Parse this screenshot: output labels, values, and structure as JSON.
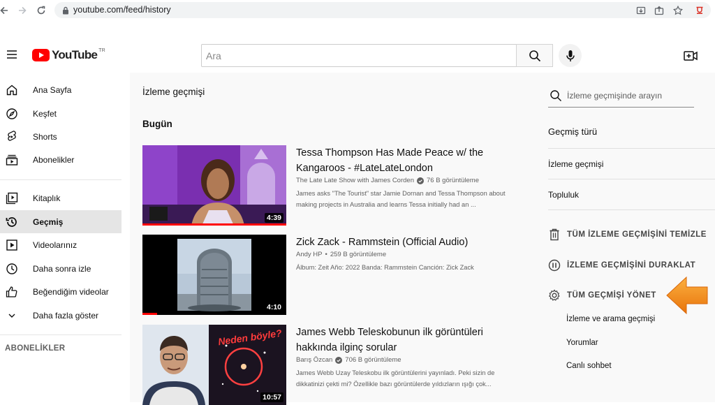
{
  "browser": {
    "url": "youtube.com/feed/history"
  },
  "header": {
    "logo_text": "YouTube",
    "logo_superscript": "TR",
    "search_placeholder": "Ara",
    "icons": [
      "menu-icon",
      "search-icon",
      "mic-icon",
      "create-video-icon"
    ]
  },
  "sidebar": {
    "items": [
      {
        "label": "Ana Sayfa",
        "icon": "home-icon"
      },
      {
        "label": "Keşfet",
        "icon": "compass-icon"
      },
      {
        "label": "Shorts",
        "icon": "shorts-icon"
      },
      {
        "label": "Abonelikler",
        "icon": "subscriptions-icon"
      },
      {
        "label": "Kitaplık",
        "icon": "library-icon"
      },
      {
        "label": "Geçmiş",
        "icon": "history-icon",
        "active": true
      },
      {
        "label": "Videolarınız",
        "icon": "your-videos-icon"
      },
      {
        "label": "Daha sonra izle",
        "icon": "clock-icon"
      },
      {
        "label": "Beğendiğim videolar",
        "icon": "thumb-up-icon"
      },
      {
        "label": "Daha fazla göster",
        "icon": "chevron-down-icon"
      }
    ],
    "section_title": "ABONELİKLER"
  },
  "main": {
    "page_title": "İzleme geçmişi",
    "date_group": "Bugün",
    "videos": [
      {
        "title": "Tessa Thompson Has Made Peace w/ the Kangaroos - #LateLateLondon",
        "channel": "The Late Late Show with James Corden",
        "verified": true,
        "views": "76 B görüntüleme",
        "description": "James asks \"The Tourist\" star Jamie Dornan and Tessa Thompson about making projects in Australia and learns Tessa initially had an ...",
        "duration": "4:39",
        "watched_fraction": 1.0
      },
      {
        "title": "Zick Zack - Rammstein (Official Audio)",
        "channel": "Andy HP",
        "verified": false,
        "views": "259 B görüntüleme",
        "description": "Álbum: Zeit Año: 2022 Banda: Rammstein Canción: Zick Zack",
        "duration": "4:10",
        "watched_fraction": 0.1
      },
      {
        "title": "James Webb Teleskobunun ilk görüntüleri hakkında ilginç sorular",
        "channel": "Barış Özcan",
        "verified": true,
        "views": "706 B görüntüleme",
        "description": "James Webb Uzay Teleskobu ilk görüntülerini yayınladı. Peki sizin de dikkatinizi çekti mi? Özellikle bazı görüntülerde yıldızların ışığı çok...",
        "duration": "10:57",
        "thumb_text": "Neden böyle?"
      }
    ]
  },
  "right_panel": {
    "search_placeholder": "İzleme geçmişinde arayın",
    "history_type_heading": "Geçmiş türü",
    "options": [
      "İzleme geçmişi",
      "Topluluk"
    ],
    "actions": [
      {
        "label": "TÜM İZLEME GEÇMİŞİNİ TEMİZLE",
        "icon": "trash-icon"
      },
      {
        "label": "İZLEME GEÇMİŞİNİ DURAKLAT",
        "icon": "pause-circle-icon"
      },
      {
        "label": "TÜM GEÇMİŞİ YÖNET",
        "icon": "gear-icon"
      }
    ],
    "sub_links": [
      "İzleme ve arama geçmişi",
      "Yorumlar",
      "Canlı sohbet"
    ]
  },
  "colors": {
    "brand_red": "#ff0000",
    "arrow_orange": "#f7941d"
  }
}
